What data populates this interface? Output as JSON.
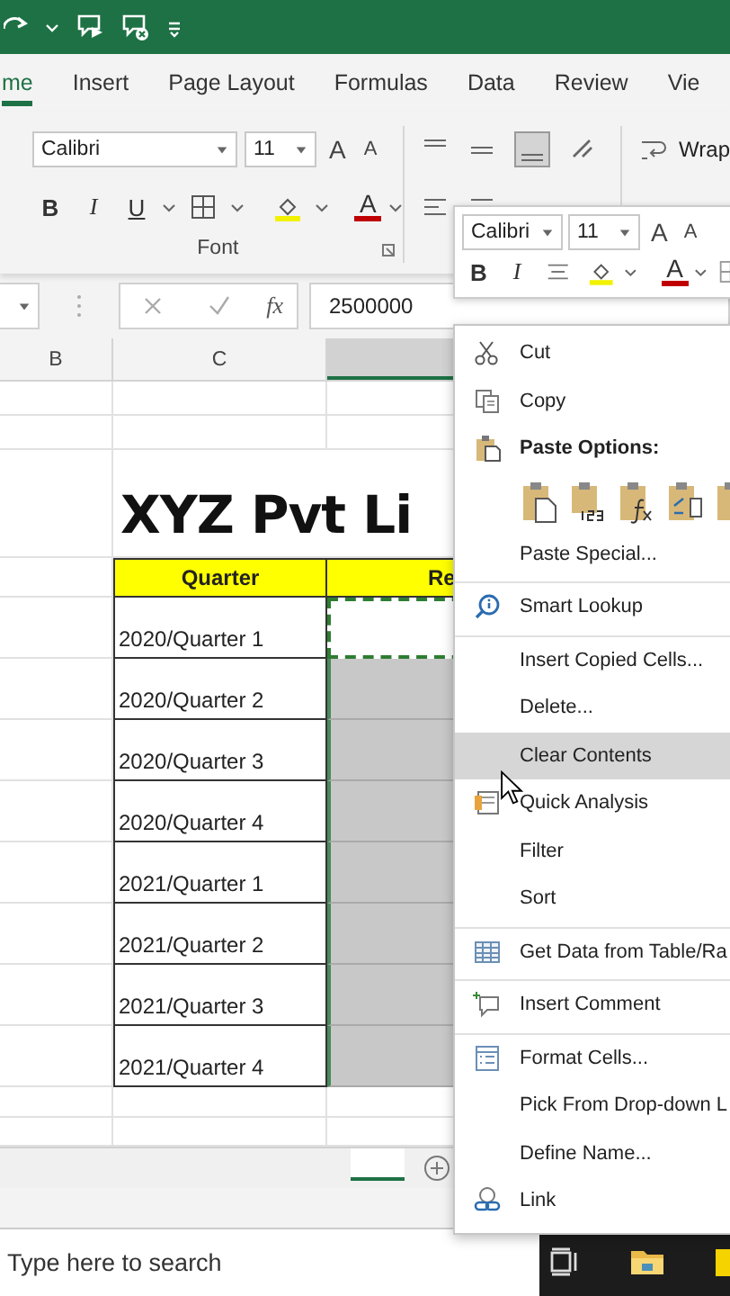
{
  "tabs": [
    {
      "label": "me",
      "selected": true
    },
    {
      "label": "Insert",
      "selected": false
    },
    {
      "label": "Page Layout",
      "selected": false
    },
    {
      "label": "Formulas",
      "selected": false
    },
    {
      "label": "Data",
      "selected": false
    },
    {
      "label": "Review",
      "selected": false
    },
    {
      "label": "Vie",
      "selected": false
    }
  ],
  "ribbon": {
    "font_name": "Calibri",
    "font_size": "11",
    "grow": "A",
    "shrink": "A",
    "bold": "B",
    "italic": "I",
    "underline": "U",
    "font_color": "A",
    "group_label": "Font",
    "wrap": "Wrap"
  },
  "formula_bar": {
    "fx": "fx",
    "value": "2500000"
  },
  "columns": [
    {
      "label": "B",
      "selected": false
    },
    {
      "label": "C",
      "selected": false
    },
    {
      "selected": true
    }
  ],
  "sheet": {
    "title": "XYZ Pvt Li",
    "headers": [
      "Quarter",
      "Re"
    ],
    "rows": [
      {
        "quarter": "2020/Quarter 1",
        "active": true
      },
      {
        "quarter": "2020/Quarter 2",
        "active": false
      },
      {
        "quarter": "2020/Quarter 3",
        "active": false
      },
      {
        "quarter": "2020/Quarter 4",
        "active": false
      },
      {
        "quarter": "2021/Quarter 1",
        "active": false
      },
      {
        "quarter": "2021/Quarter 2",
        "active": false
      },
      {
        "quarter": "2021/Quarter 3",
        "active": false
      },
      {
        "quarter": "2021/Quarter 4",
        "active": false
      }
    ]
  },
  "mini_toolbar": {
    "font_name": "Calibri",
    "font_size": "11",
    "grow": "A",
    "shrink": "A",
    "bold": "B",
    "italic": "I",
    "font_color": "A"
  },
  "context_menu": [
    {
      "kind": "item",
      "label": "Cut",
      "highlighted": false,
      "separator_above": false
    },
    {
      "kind": "item",
      "label": "Copy",
      "highlighted": false,
      "separator_above": false
    },
    {
      "kind": "heading",
      "label": "Paste Options:",
      "highlighted": false,
      "separator_above": false
    },
    {
      "kind": "paste-options",
      "highlighted": false,
      "separator_above": false
    },
    {
      "kind": "item",
      "label": "Paste Special...",
      "highlighted": false,
      "separator_above": false
    },
    {
      "kind": "item",
      "label": "Smart Lookup",
      "highlighted": false,
      "separator_above": true
    },
    {
      "kind": "item",
      "label": "Insert Copied Cells...",
      "highlighted": false,
      "separator_above": true
    },
    {
      "kind": "item",
      "label": "Delete...",
      "highlighted": false,
      "separator_above": false
    },
    {
      "kind": "item",
      "label": "Clear Contents",
      "highlighted": true,
      "separator_above": false
    },
    {
      "kind": "item",
      "label": "Quick Analysis",
      "highlighted": false,
      "separator_above": false
    },
    {
      "kind": "item",
      "label": "Filter",
      "highlighted": false,
      "separator_above": false
    },
    {
      "kind": "item",
      "label": "Sort",
      "highlighted": false,
      "separator_above": false
    },
    {
      "kind": "item",
      "label": "Get Data from Table/Ra",
      "highlighted": false,
      "separator_above": true
    },
    {
      "kind": "item",
      "label": "Insert Comment",
      "highlighted": false,
      "separator_above": true
    },
    {
      "kind": "item",
      "label": "Format Cells...",
      "highlighted": false,
      "separator_above": true
    },
    {
      "kind": "item",
      "label": "Pick From Drop-down L",
      "highlighted": false,
      "separator_above": false
    },
    {
      "kind": "item",
      "label": "Define Name...",
      "highlighted": false,
      "separator_above": false
    },
    {
      "kind": "item",
      "label": "Link",
      "highlighted": false,
      "separator_above": false
    }
  ],
  "taskbar": {
    "search_placeholder": "Type here to search"
  }
}
